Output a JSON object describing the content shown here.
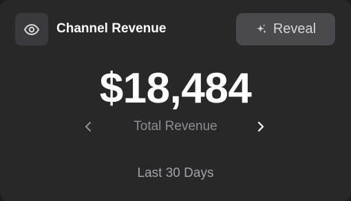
{
  "card": {
    "title": "Channel Revenue",
    "toggle_icon": "eye-icon",
    "reveal_icon": "sparkle-icon",
    "reveal_label": "Reveal",
    "value": "$18,484",
    "metric_label": "Total Revenue",
    "prev_icon": "chevron-left-icon",
    "next_icon": "chevron-right-icon",
    "period": "Last 30 Days"
  },
  "colors": {
    "background": "#282828",
    "button": "#3a3a3c",
    "reveal_button": "#4a4a4d",
    "text_primary": "#ffffff",
    "text_secondary": "#8e8e93"
  }
}
